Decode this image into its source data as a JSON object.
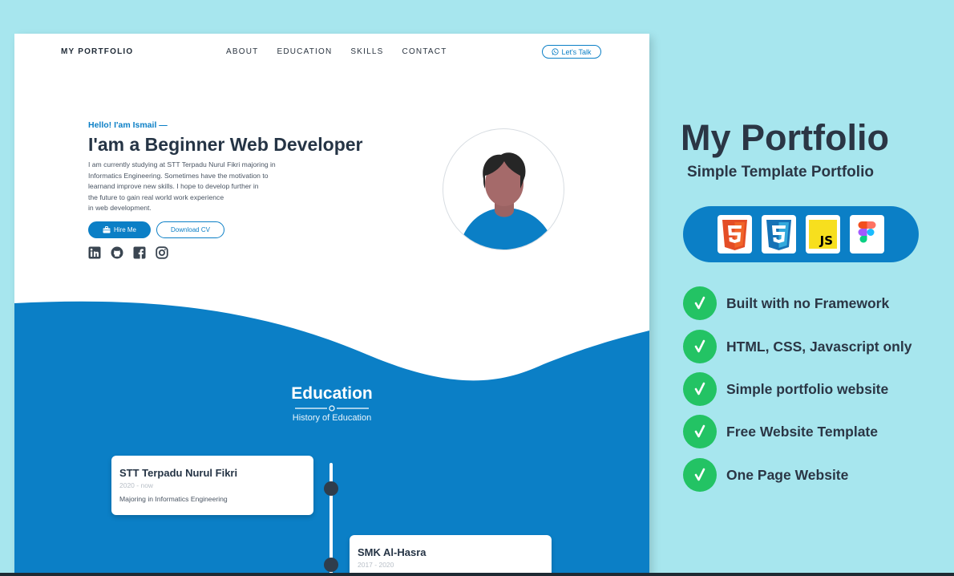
{
  "colors": {
    "background": "#a7e6ee",
    "primary": "#0b7fc6",
    "dark_text": "#253445",
    "check_green": "#23c364",
    "timeline_dot": "#2f3d4c"
  },
  "nav": {
    "brand": "MY PORTFOLIO",
    "links": [
      "ABOUT",
      "EDUCATION",
      "SKILLS",
      "CONTACT"
    ],
    "cta_label": "Let's Talk",
    "cta_icon": "whatsapp-icon"
  },
  "hero": {
    "greeting": "Hello! I'am Ismail —",
    "headline": "I'am a Beginner Web Developer",
    "intro_lines": [
      "I am currently studying at STT Terpadu Nurul Fikri majoring in",
      "Informatics Engineering. Sometimes have the motivation to",
      "learnand improve new skills. I hope to develop further in",
      "the future to gain real world work experience",
      "in web development."
    ],
    "hire_label": "Hire Me",
    "hire_icon": "briefcase-icon",
    "cv_label": "Download CV",
    "socials": [
      "linkedin-icon",
      "github-icon",
      "facebook-icon",
      "instagram-icon"
    ]
  },
  "education": {
    "title": "Education",
    "subtitle": "History of Education",
    "items": [
      {
        "school": "STT Terpadu Nurul Fikri",
        "years": "2020 - now",
        "desc": "Majoring in Informatics Engineering"
      },
      {
        "school": "SMK Al-Hasra",
        "years": "2017 - 2020",
        "desc": ""
      }
    ]
  },
  "promo": {
    "title": "My Portfolio",
    "subtitle": "Simple Template Portfolio",
    "tech_icons": [
      "html5-icon",
      "css3-icon",
      "javascript-icon",
      "figma-icon"
    ],
    "features": [
      "Built with no Framework",
      "HTML, CSS, Javascript only",
      "Simple portfolio website",
      "Free Website Template",
      "One Page Website"
    ]
  }
}
